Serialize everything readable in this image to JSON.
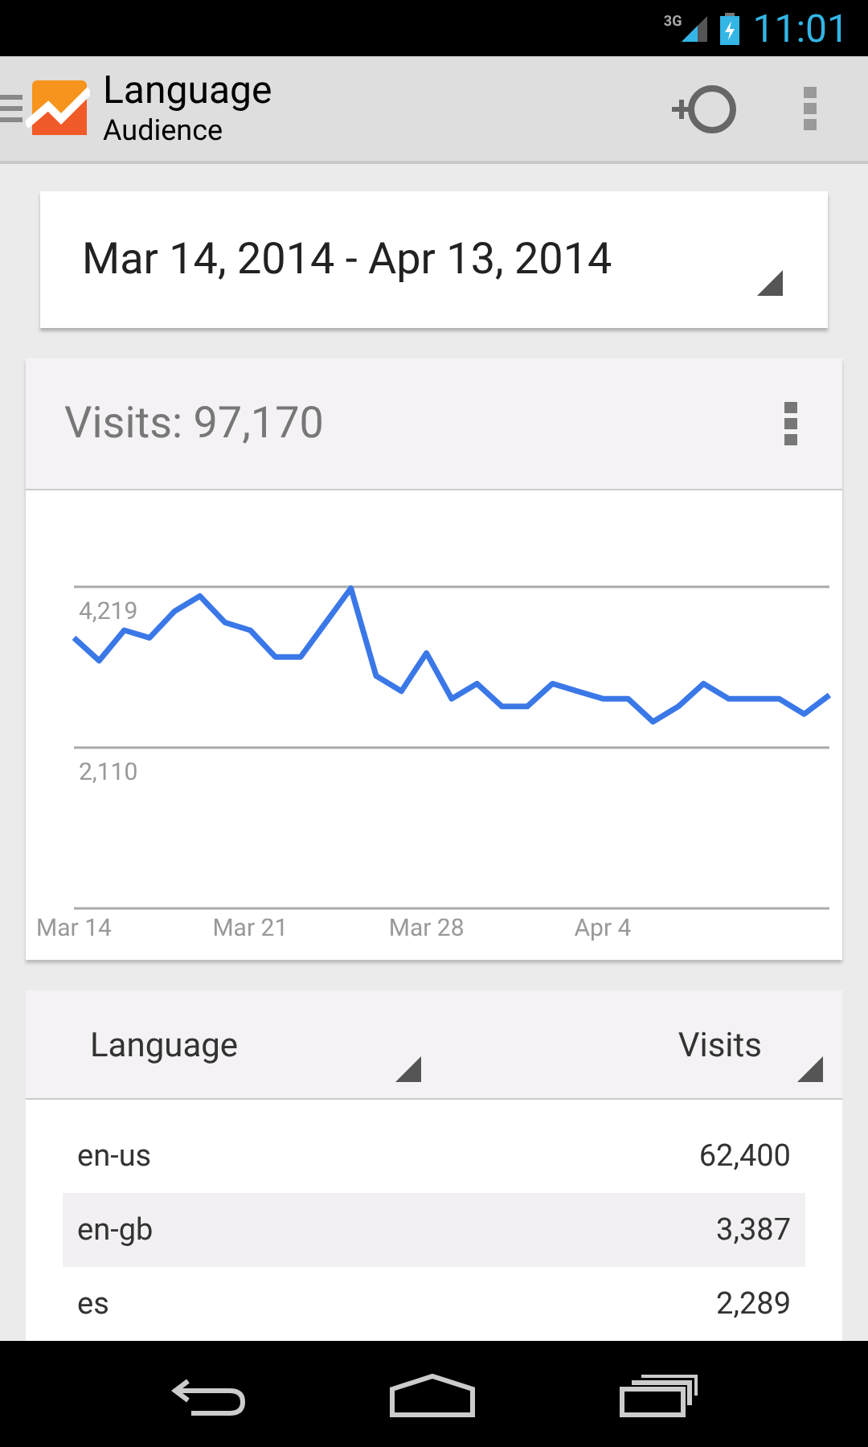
{
  "status_bar": {
    "network": "3G",
    "time": "11:01"
  },
  "action_bar": {
    "title": "Language",
    "subtitle": "Audience"
  },
  "date_range": {
    "value": "Mar 14, 2014 - Apr 13, 2014"
  },
  "chart_card": {
    "title": "Visits: 97,170",
    "chart_data": {
      "type": "line",
      "categories": [
        "Mar 14",
        null,
        null,
        null,
        null,
        null,
        null,
        "Mar 21",
        null,
        null,
        null,
        null,
        null,
        null,
        "Mar 28",
        null,
        null,
        null,
        null,
        null,
        null,
        "Apr 4",
        null,
        null,
        null,
        null,
        null,
        null,
        null,
        null,
        null
      ],
      "series": [
        {
          "color": "#3b78e7",
          "values": [
            3550,
            3250,
            3650,
            3550,
            3900,
            4100,
            3750,
            3650,
            3300,
            3300,
            3750,
            4200,
            3050,
            2850,
            3350,
            2750,
            2950,
            2650,
            2650,
            2950,
            2850,
            2750,
            2750,
            2450,
            2650,
            2950,
            2750,
            2750,
            2750,
            2550,
            2800
          ]
        }
      ],
      "ylim": [
        0,
        5485
      ],
      "yticks": [
        {
          "value": 2110,
          "label": "2,110"
        },
        {
          "value": 4219,
          "label": "4,219"
        }
      ]
    }
  },
  "table": {
    "columns": [
      "Language",
      "Visits"
    ],
    "rows": [
      {
        "language": "en-us",
        "visits": "62,400",
        "selected": false
      },
      {
        "language": "en-gb",
        "visits": "3,387",
        "selected": true
      },
      {
        "language": "es",
        "visits": "2,289",
        "selected": false
      }
    ]
  }
}
